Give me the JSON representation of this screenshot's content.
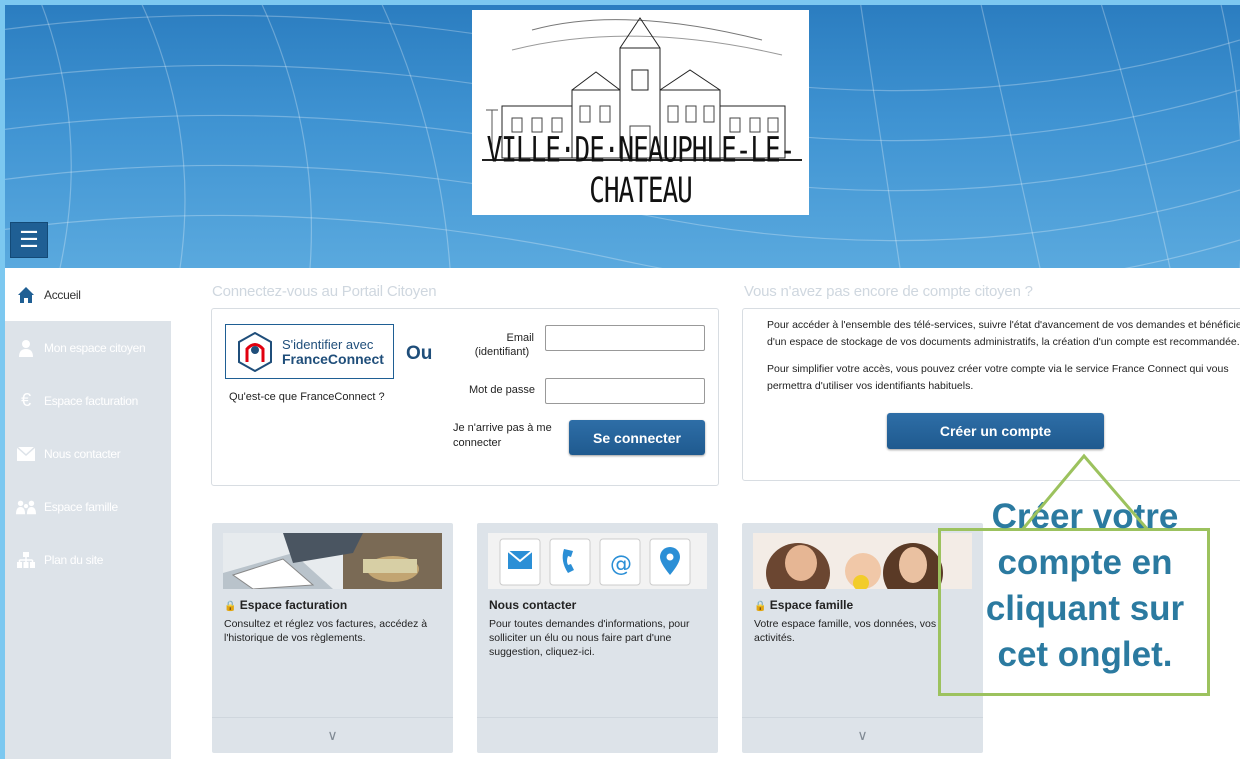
{
  "header": {
    "logo_text": "VILLE·DE·NEAUPHLE-LE-CHATEAU"
  },
  "sidebar": {
    "menu_icon": "hamburger-icon",
    "items": [
      {
        "label": "Accueil",
        "icon": "home-icon",
        "active": true
      },
      {
        "label": "Mon espace citoyen",
        "icon": "user-icon"
      },
      {
        "label": "Espace facturation",
        "icon": "euro-icon"
      },
      {
        "label": "Nous contacter",
        "icon": "envelope-icon"
      },
      {
        "label": "Espace famille",
        "icon": "family-icon"
      },
      {
        "label": "Plan du site",
        "icon": "sitemap-icon"
      }
    ]
  },
  "login": {
    "title": "Connectez-vous au Portail Citoyen",
    "franceconnect_line1": "S'identifier avec",
    "franceconnect_line2": "FranceConnect",
    "or_label": "Ou",
    "franceconnect_what": "Qu'est-ce que FranceConnect ?",
    "email_label": "Email",
    "email_sublabel": "(identifiant)",
    "email_value": "",
    "password_label": "Mot de passe",
    "password_value": "",
    "forgot_label": "Je n'arrive pas à me connecter",
    "submit_label": "Se connecter"
  },
  "register": {
    "title": "Vous n'avez pas encore de compte citoyen ?",
    "paragraph1": "Pour accéder à l'ensemble des télé-services, suivre l'état d'avancement de vos demandes et bénéficier d'un espace de stockage de vos documents administratifs, la création d'un compte est recommandée.",
    "paragraph2": "Pour simplifier votre accès, vous pouvez créer votre compte via le service France Connect qui vous permettra d'utiliser vos identifiants habituels.",
    "button_label": "Créer un compte"
  },
  "cards": [
    {
      "title": "Espace facturation",
      "locked": true,
      "description": "Consultez et réglez vos factures, accédez à l'historique de vos règlements.",
      "lock_icon": "lock-icon"
    },
    {
      "title": "Nous contacter",
      "locked": false,
      "description": "Pour toutes demandes d'informations, pour solliciter un élu ou nous faire part d'une suggestion, cliquez-ici."
    },
    {
      "title": "Espace famille",
      "locked": true,
      "description": "Votre espace famille, vos données, vos activités.",
      "lock_icon": "lock-icon"
    }
  ],
  "contact_icons": [
    "envelope-icon",
    "phone-icon",
    "at-icon",
    "location-pin-icon"
  ],
  "callout": {
    "text": "Créer votre compte en cliquant sur cet onglet."
  },
  "colors": {
    "header_blue": "#3f93d2",
    "button_blue": "#1f5f94",
    "sidebar_bg": "#dde3e9",
    "callout_text": "#2b7aa0",
    "callout_border": "#9cc25e"
  }
}
